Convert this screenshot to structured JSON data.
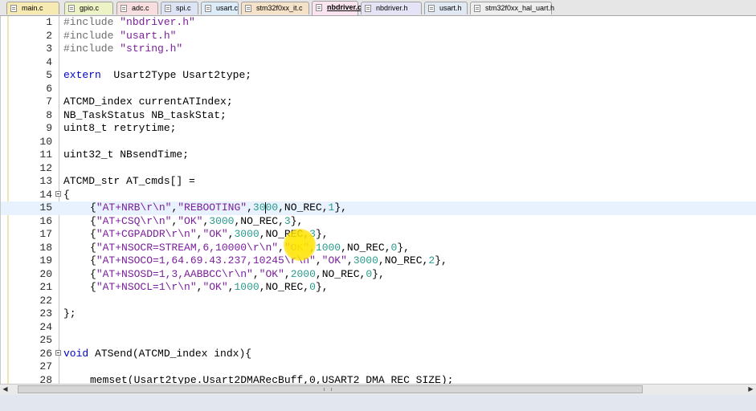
{
  "tabs": [
    {
      "label": "main.c",
      "bg": "#f6e9b2",
      "active": false
    },
    {
      "label": "gpio.c",
      "bg": "#eef3c6",
      "active": false
    },
    {
      "label": "adc.c",
      "bg": "#f8dede",
      "active": false
    },
    {
      "label": "spi.c",
      "bg": "#dde4f6",
      "active": false
    },
    {
      "label": "usart.c",
      "bg": "#dcecf8",
      "active": false
    },
    {
      "label": "stm32f0xx_it.c",
      "bg": "#f6e2c8",
      "active": false
    },
    {
      "label": "nbdriver.c",
      "bg": "#fbe3f0",
      "active": true
    },
    {
      "label": "nbdriver.h",
      "bg": "#e4e4f6",
      "active": false
    },
    {
      "label": "usart.h",
      "bg": "#dfe8f3",
      "active": false
    },
    {
      "label": "stm32f0xx_hal_uart.h",
      "bg": "#eeeeee",
      "active": false
    }
  ],
  "editor": {
    "current_line": 15,
    "lines": [
      {
        "n": "1",
        "fold": false,
        "indent": false,
        "tokens": [
          [
            "pp",
            "#include "
          ],
          [
            "st",
            "\"nbdriver.h\""
          ]
        ]
      },
      {
        "n": "2",
        "fold": false,
        "indent": false,
        "tokens": [
          [
            "pp",
            "#include "
          ],
          [
            "st",
            "\"usart.h\""
          ]
        ]
      },
      {
        "n": "3",
        "fold": false,
        "indent": false,
        "tokens": [
          [
            "pp",
            "#include "
          ],
          [
            "st",
            "\"string.h\""
          ]
        ]
      },
      {
        "n": "4",
        "fold": false,
        "indent": false,
        "tokens": []
      },
      {
        "n": "5",
        "fold": false,
        "indent": false,
        "tokens": [
          [
            "kw",
            "extern"
          ],
          [
            "",
            "  Usart2Type Usart2type;"
          ]
        ]
      },
      {
        "n": "6",
        "fold": false,
        "indent": false,
        "tokens": []
      },
      {
        "n": "7",
        "fold": false,
        "indent": false,
        "tokens": [
          [
            "",
            "ATCMD_index currentATIndex;"
          ]
        ]
      },
      {
        "n": "8",
        "fold": false,
        "indent": false,
        "tokens": [
          [
            "",
            "NB_TaskStatus NB_taskStat;"
          ]
        ]
      },
      {
        "n": "9",
        "fold": false,
        "indent": false,
        "tokens": [
          [
            "",
            "uint8_t retrytime;"
          ]
        ]
      },
      {
        "n": "10",
        "fold": false,
        "indent": false,
        "tokens": []
      },
      {
        "n": "11",
        "fold": false,
        "indent": false,
        "tokens": [
          [
            "",
            "uint32_t NBsendTime;"
          ]
        ]
      },
      {
        "n": "12",
        "fold": false,
        "indent": false,
        "tokens": []
      },
      {
        "n": "13",
        "fold": false,
        "indent": false,
        "tokens": [
          [
            "",
            "ATCMD_str AT_cmds[] ="
          ]
        ]
      },
      {
        "n": "14",
        "fold": true,
        "indent": false,
        "tokens": [
          [
            "",
            "{"
          ]
        ]
      },
      {
        "n": "15",
        "fold": false,
        "indent": true,
        "tokens": [
          [
            "",
            "{"
          ],
          [
            "st",
            "\"AT+NRB\\r\\n\""
          ],
          [
            "",
            ","
          ],
          [
            "st",
            "\"REBOOTING\""
          ],
          [
            "",
            ","
          ],
          [
            "nm",
            "3000"
          ],
          [
            "",
            ",NO_REC,"
          ],
          [
            "nm",
            "1"
          ],
          [
            "",
            "},"
          ]
        ]
      },
      {
        "n": "16",
        "fold": false,
        "indent": true,
        "tokens": [
          [
            "",
            "{"
          ],
          [
            "st",
            "\"AT+CSQ\\r\\n\""
          ],
          [
            "",
            ","
          ],
          [
            "st",
            "\"OK\""
          ],
          [
            "",
            ","
          ],
          [
            "nm",
            "3000"
          ],
          [
            "",
            ",NO_REC,"
          ],
          [
            "nm",
            "3"
          ],
          [
            "",
            "},"
          ]
        ]
      },
      {
        "n": "17",
        "fold": false,
        "indent": true,
        "tokens": [
          [
            "",
            "{"
          ],
          [
            "st",
            "\"AT+CGPADDR\\r\\n\""
          ],
          [
            "",
            ","
          ],
          [
            "st",
            "\"OK\""
          ],
          [
            "",
            ","
          ],
          [
            "nm",
            "3000"
          ],
          [
            "",
            ",NO_REC,"
          ],
          [
            "nm",
            "3"
          ],
          [
            "",
            "},"
          ]
        ]
      },
      {
        "n": "18",
        "fold": false,
        "indent": true,
        "tokens": [
          [
            "",
            "{"
          ],
          [
            "st",
            "\"AT+NSOCR=STREAM,6,10000\\r\\n\""
          ],
          [
            "",
            ","
          ],
          [
            "st",
            "\"OK\""
          ],
          [
            "",
            ","
          ],
          [
            "nm",
            "1000"
          ],
          [
            "",
            ",NO_REC,"
          ],
          [
            "nm",
            "0"
          ],
          [
            "",
            "},"
          ]
        ]
      },
      {
        "n": "19",
        "fold": false,
        "indent": true,
        "tokens": [
          [
            "",
            "{"
          ],
          [
            "st",
            "\"AT+NSOCO=1,64.69.43.237,10245\\r\\n\""
          ],
          [
            "",
            ","
          ],
          [
            "st",
            "\"OK\""
          ],
          [
            "",
            ","
          ],
          [
            "nm",
            "3000"
          ],
          [
            "",
            ",NO_REC,"
          ],
          [
            "nm",
            "2"
          ],
          [
            "",
            "},"
          ]
        ]
      },
      {
        "n": "20",
        "fold": false,
        "indent": true,
        "tokens": [
          [
            "",
            "{"
          ],
          [
            "st",
            "\"AT+NSOSD=1,3,AABBCC\\r\\n\""
          ],
          [
            "",
            ","
          ],
          [
            "st",
            "\"OK\""
          ],
          [
            "",
            ","
          ],
          [
            "nm",
            "2000"
          ],
          [
            "",
            ",NO_REC,"
          ],
          [
            "nm",
            "0"
          ],
          [
            "",
            "},"
          ]
        ]
      },
      {
        "n": "21",
        "fold": false,
        "indent": true,
        "tokens": [
          [
            "",
            "{"
          ],
          [
            "st",
            "\"AT+NSOCL=1\\r\\n\""
          ],
          [
            "",
            ","
          ],
          [
            "st",
            "\"OK\""
          ],
          [
            "",
            ","
          ],
          [
            "nm",
            "1000"
          ],
          [
            "",
            ",NO_REC,"
          ],
          [
            "nm",
            "0"
          ],
          [
            "",
            "},"
          ]
        ]
      },
      {
        "n": "22",
        "fold": false,
        "indent": false,
        "tokens": []
      },
      {
        "n": "23",
        "fold": false,
        "indent": false,
        "tokens": [
          [
            "",
            "};"
          ]
        ]
      },
      {
        "n": "24",
        "fold": false,
        "indent": false,
        "tokens": []
      },
      {
        "n": "25",
        "fold": false,
        "indent": false,
        "tokens": []
      },
      {
        "n": "26",
        "fold": true,
        "indent": false,
        "tokens": [
          [
            "kw",
            "void"
          ],
          [
            "",
            " ATSend(ATCMD_index indx){"
          ]
        ]
      },
      {
        "n": "27",
        "fold": false,
        "indent": false,
        "tokens": []
      },
      {
        "n": "28",
        "fold": false,
        "indent": true,
        "tokens": [
          [
            "",
            "memset(Usart2type.Usart2DMARecBuff,0,USART2_DMA_REC_SIZE);"
          ]
        ]
      }
    ]
  },
  "scrollbar": {
    "left_arrow": "◀",
    "right_arrow": "▶"
  },
  "colors": {
    "mouse_highlight": "#ffe600",
    "current_line": "#e8f2fe"
  }
}
